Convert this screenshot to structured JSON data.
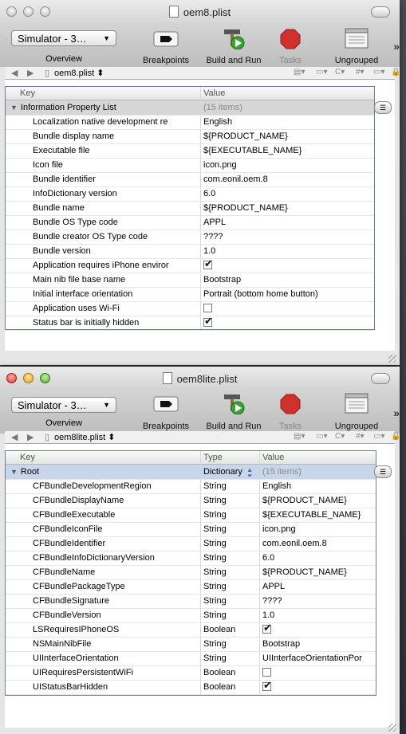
{
  "window1": {
    "title": "oem8.plist",
    "toolbar": {
      "scheme_select": "Simulator - 3…",
      "overview": "Overview",
      "breakpoints": "Breakpoints",
      "build_and_run": "Build and Run",
      "tasks": "Tasks",
      "ungrouped": "Ungrouped"
    },
    "nav_file": "oem8.plist",
    "nav_file_suffix": "⬍",
    "columns": [
      "Key",
      "Value"
    ],
    "root": {
      "key": "Information Property List",
      "value": "(15 items)"
    },
    "rows": [
      {
        "key": "Localization native development re",
        "value": "English"
      },
      {
        "key": "Bundle display name",
        "value": "${PRODUCT_NAME}"
      },
      {
        "key": "Executable file",
        "value": "${EXECUTABLE_NAME}"
      },
      {
        "key": "Icon file",
        "value": "icon.png"
      },
      {
        "key": "Bundle identifier",
        "value": "com.eonil.oem.8"
      },
      {
        "key": "InfoDictionary version",
        "value": "6.0"
      },
      {
        "key": "Bundle name",
        "value": "${PRODUCT_NAME}"
      },
      {
        "key": "Bundle OS Type code",
        "value": "APPL"
      },
      {
        "key": "Bundle creator OS Type code",
        "value": "????"
      },
      {
        "key": "Bundle version",
        "value": "1.0"
      },
      {
        "key": "Application requires iPhone enviror",
        "check": true
      },
      {
        "key": "Main nib file base name",
        "value": "Bootstrap"
      },
      {
        "key": "Initial interface orientation",
        "value": "Portrait (bottom home button)"
      },
      {
        "key": "Application uses Wi-Fi",
        "check": false
      },
      {
        "key": "Status bar is initially hidden",
        "check": true
      }
    ]
  },
  "window2": {
    "title": "oem8lite.plist",
    "toolbar": {
      "scheme_select": "Simulator - 3…",
      "overview": "Overview",
      "breakpoints": "Breakpoints",
      "build_and_run": "Build and Run",
      "tasks": "Tasks",
      "ungrouped": "Ungrouped"
    },
    "nav_file": "oem8lite.plist",
    "nav_file_suffix": "⬍",
    "columns": [
      "Key",
      "Type",
      "Value"
    ],
    "root": {
      "key": "Root",
      "type": "Dictionary",
      "value": "(15 items)"
    },
    "rows": [
      {
        "key": "CFBundleDevelopmentRegion",
        "type": "String",
        "value": "English"
      },
      {
        "key": "CFBundleDisplayName",
        "type": "String",
        "value": "${PRODUCT_NAME}"
      },
      {
        "key": "CFBundleExecutable",
        "type": "String",
        "value": "${EXECUTABLE_NAME}"
      },
      {
        "key": "CFBundleIconFile",
        "type": "String",
        "value": "icon.png"
      },
      {
        "key": "CFBundleIdentifier",
        "type": "String",
        "value": "com.eonil.oem.8"
      },
      {
        "key": "CFBundleInfoDictionaryVersion",
        "type": "String",
        "value": "6.0"
      },
      {
        "key": "CFBundleName",
        "type": "String",
        "value": "${PRODUCT_NAME}"
      },
      {
        "key": "CFBundlePackageType",
        "type": "String",
        "value": "APPL"
      },
      {
        "key": "CFBundleSignature",
        "type": "String",
        "value": "????"
      },
      {
        "key": "CFBundleVersion",
        "type": "String",
        "value": "1.0"
      },
      {
        "key": "LSRequiresIPhoneOS",
        "type": "Boolean",
        "check": true
      },
      {
        "key": "NSMainNibFile",
        "type": "String",
        "value": "Bootstrap"
      },
      {
        "key": "UIInterfaceOrientation",
        "type": "String",
        "value": "UIInterfaceOrientationPor"
      },
      {
        "key": "UIRequiresPersistentWiFi",
        "type": "Boolean",
        "check": false
      },
      {
        "key": "UIStatusBarHidden",
        "type": "Boolean",
        "check": true
      }
    ]
  },
  "colors": {
    "tasks_red": "#d0312d",
    "build_green": "#3aa335",
    "selection_blue": "#c7d6ea"
  }
}
